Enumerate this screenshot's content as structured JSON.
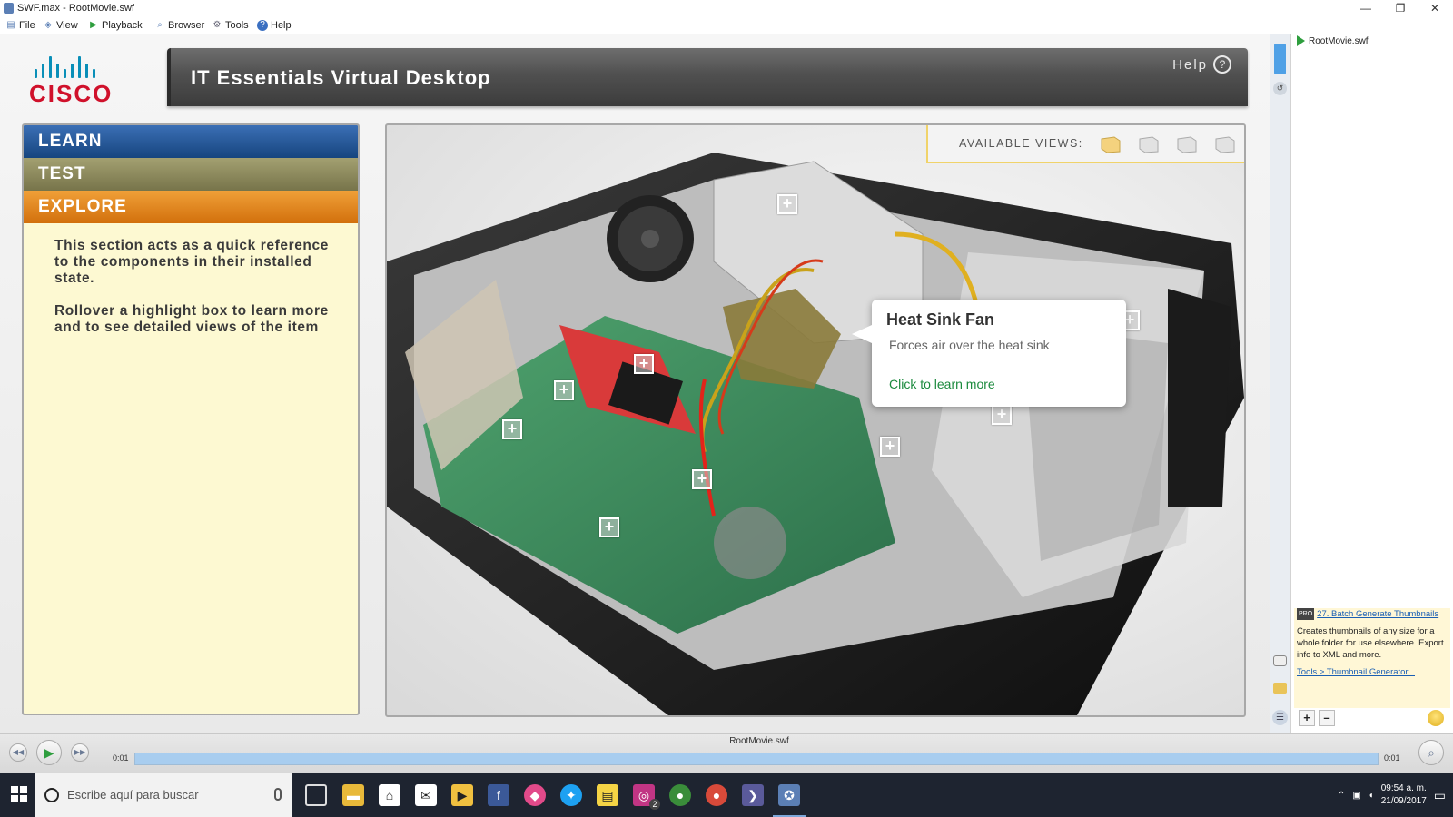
{
  "window": {
    "title": "SWF.max - RootMovie.swf",
    "minimize_glyph": "—",
    "restore_glyph": "❐",
    "close_glyph": "✕"
  },
  "menu": [
    {
      "label": "File",
      "icon": "file-icon"
    },
    {
      "label": "View",
      "icon": "view-icon"
    },
    {
      "label": "Playback",
      "icon": "play-icon"
    },
    {
      "label": "Browser",
      "icon": "browser-icon"
    },
    {
      "label": "Tools",
      "icon": "gear-icon"
    },
    {
      "label": "Help",
      "icon": "help-icon"
    }
  ],
  "movie": {
    "logo_text": "CISCO",
    "header_title": "IT Essentials Virtual Desktop",
    "help_label": "Help",
    "help_glyph": "?",
    "nav": {
      "learn": "LEARN",
      "test": "TEST",
      "explore": "EXPLORE"
    },
    "description": [
      "This section acts as a quick reference to the components in their installed state.",
      "Rollover a highlight box to learn more and to see detailed views of the item"
    ],
    "available_views_label": "AVAILABLE VIEWS:",
    "tooltip": {
      "title": "Heat Sink Fan",
      "description": "Forces air over the heat sink",
      "link": "Click to learn more"
    },
    "hotspot_glyph": "+"
  },
  "right_panel": {
    "file_name": "RootMovie.swf",
    "tip": {
      "badge": "PRO",
      "title": "27. Batch Generate Thumbnails",
      "body": "Creates thumbnails of any size for a whole folder for use elsewhere. Export info to XML and more.",
      "link": "Tools > Thumbnail Generator..."
    },
    "zoom_in": "+",
    "zoom_out": "–"
  },
  "playback": {
    "file_name": "RootMovie.swf",
    "time_start": "0:01",
    "time_end": "0:01",
    "progress": 1.0,
    "rewind_glyph": "◀◀",
    "play_glyph": "▶",
    "forward_glyph": "▶▶"
  },
  "taskbar": {
    "search_placeholder": "Escribe aquí para buscar",
    "time": "09:54 a. m.",
    "date": "21/09/2017",
    "instagram_badge": "2"
  },
  "colors": {
    "learn": "#16457f",
    "test": "#77744a",
    "explore": "#d2700c",
    "panel_bg": "#fdf9d2",
    "tooltip_link": "#1b8a3d",
    "cisco_red": "#d0112b",
    "cisco_blue": "#0a8fb8"
  }
}
